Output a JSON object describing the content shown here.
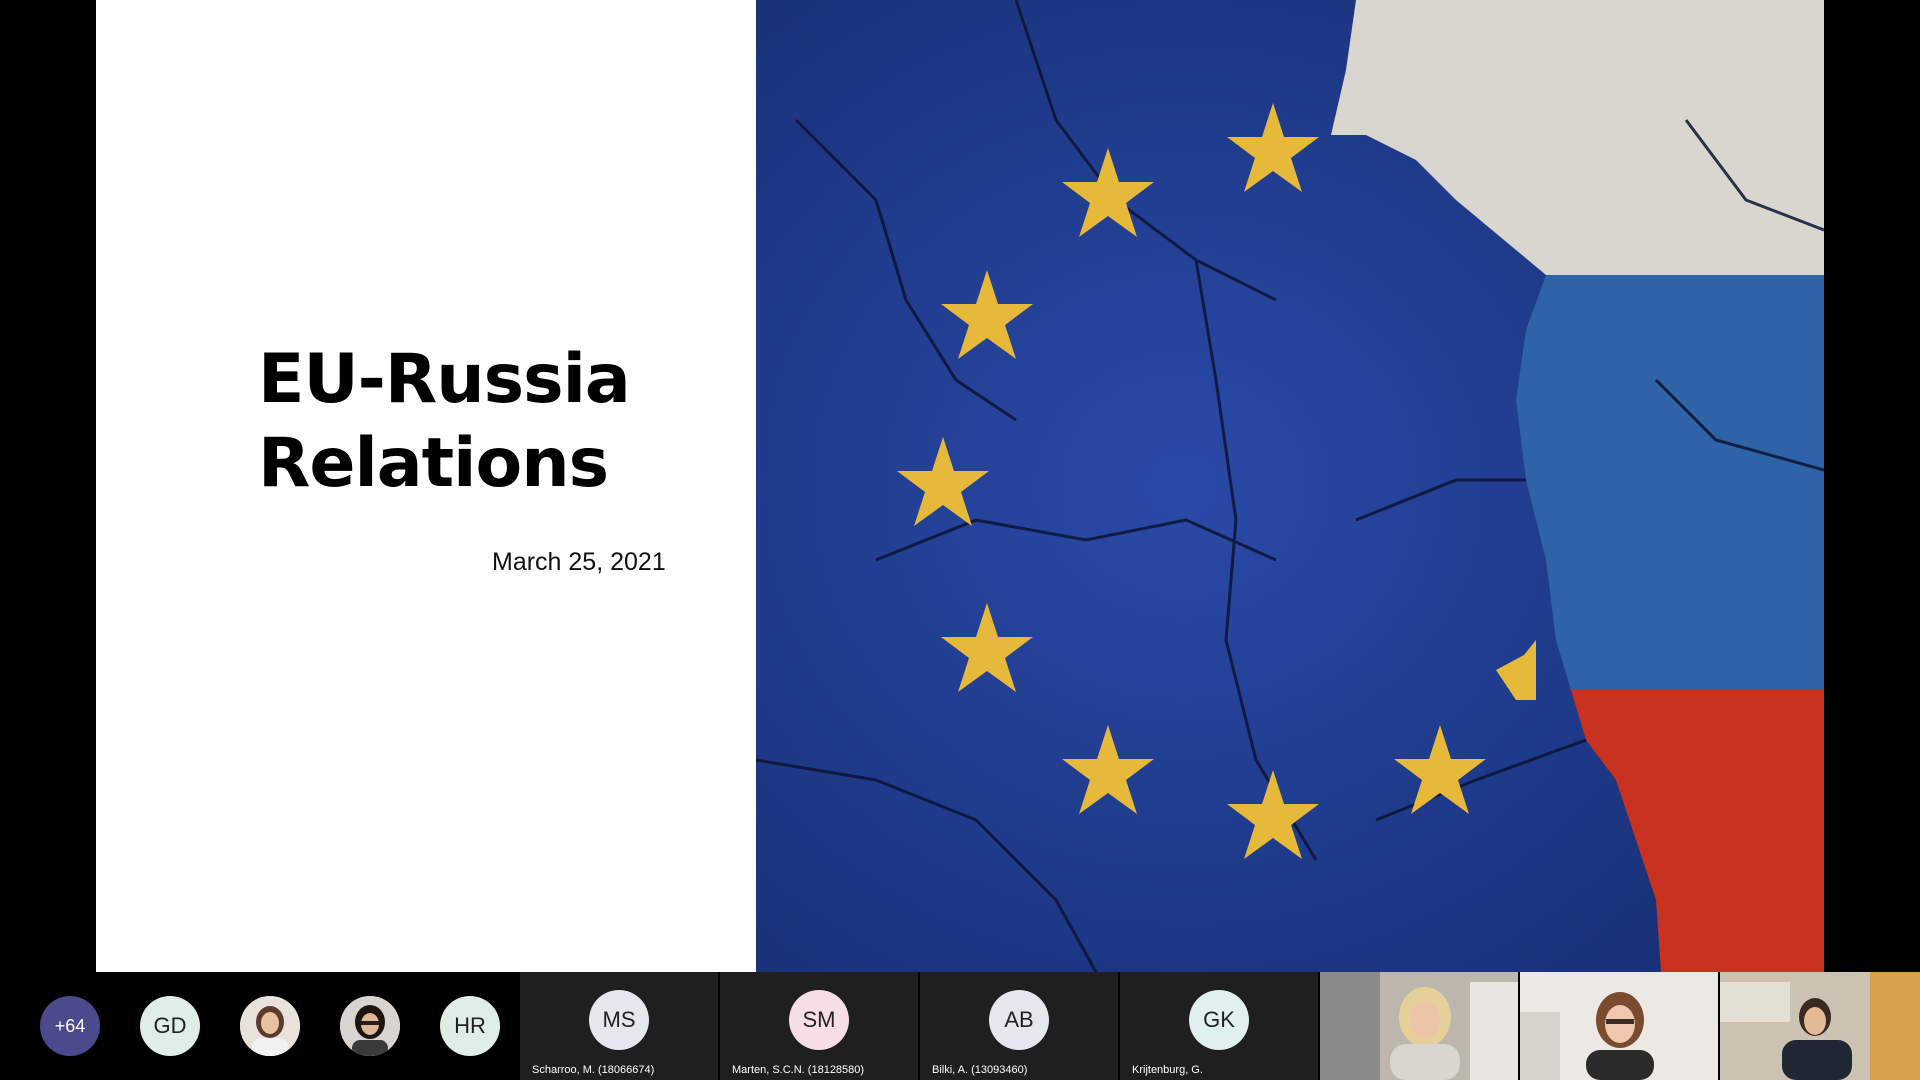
{
  "slide": {
    "title_line1": "EU-Russia",
    "title_line2": "Relations",
    "date": "March 25, 2021"
  },
  "colors": {
    "eu_blue": "#1b3a8c",
    "star_gold": "#e6b93a",
    "russia_white": "#d9d6d0",
    "russia_blue": "#2f63a8",
    "russia_red": "#c8321e",
    "overflow_badge": "#4b4a8c"
  },
  "participants": {
    "overflow": "+64",
    "bubbles": [
      {
        "initials": "GD",
        "kind": "initials",
        "bg": "#dfeee4"
      },
      {
        "kind": "photo",
        "name": "participant-photo-1"
      },
      {
        "kind": "photo",
        "name": "participant-photo-2"
      },
      {
        "initials": "HR",
        "kind": "initials",
        "bg": "#dfeee4"
      }
    ],
    "tiles": [
      {
        "initials": "MS",
        "name": "Scharroo, M. (18066674)",
        "bg": "#e4e8ee"
      },
      {
        "initials": "SM",
        "name": "Marten, S.C.N. (18128580)",
        "bg": "#f6dde6"
      },
      {
        "initials": "AB",
        "name": "Bilki, A. (13093460)",
        "bg": "#e4e8ee"
      },
      {
        "initials": "GK",
        "name": "Krijtenburg, G.",
        "bg": "#dff0ee"
      }
    ],
    "videos": [
      "video-tile-1",
      "video-tile-2",
      "video-tile-3"
    ]
  }
}
